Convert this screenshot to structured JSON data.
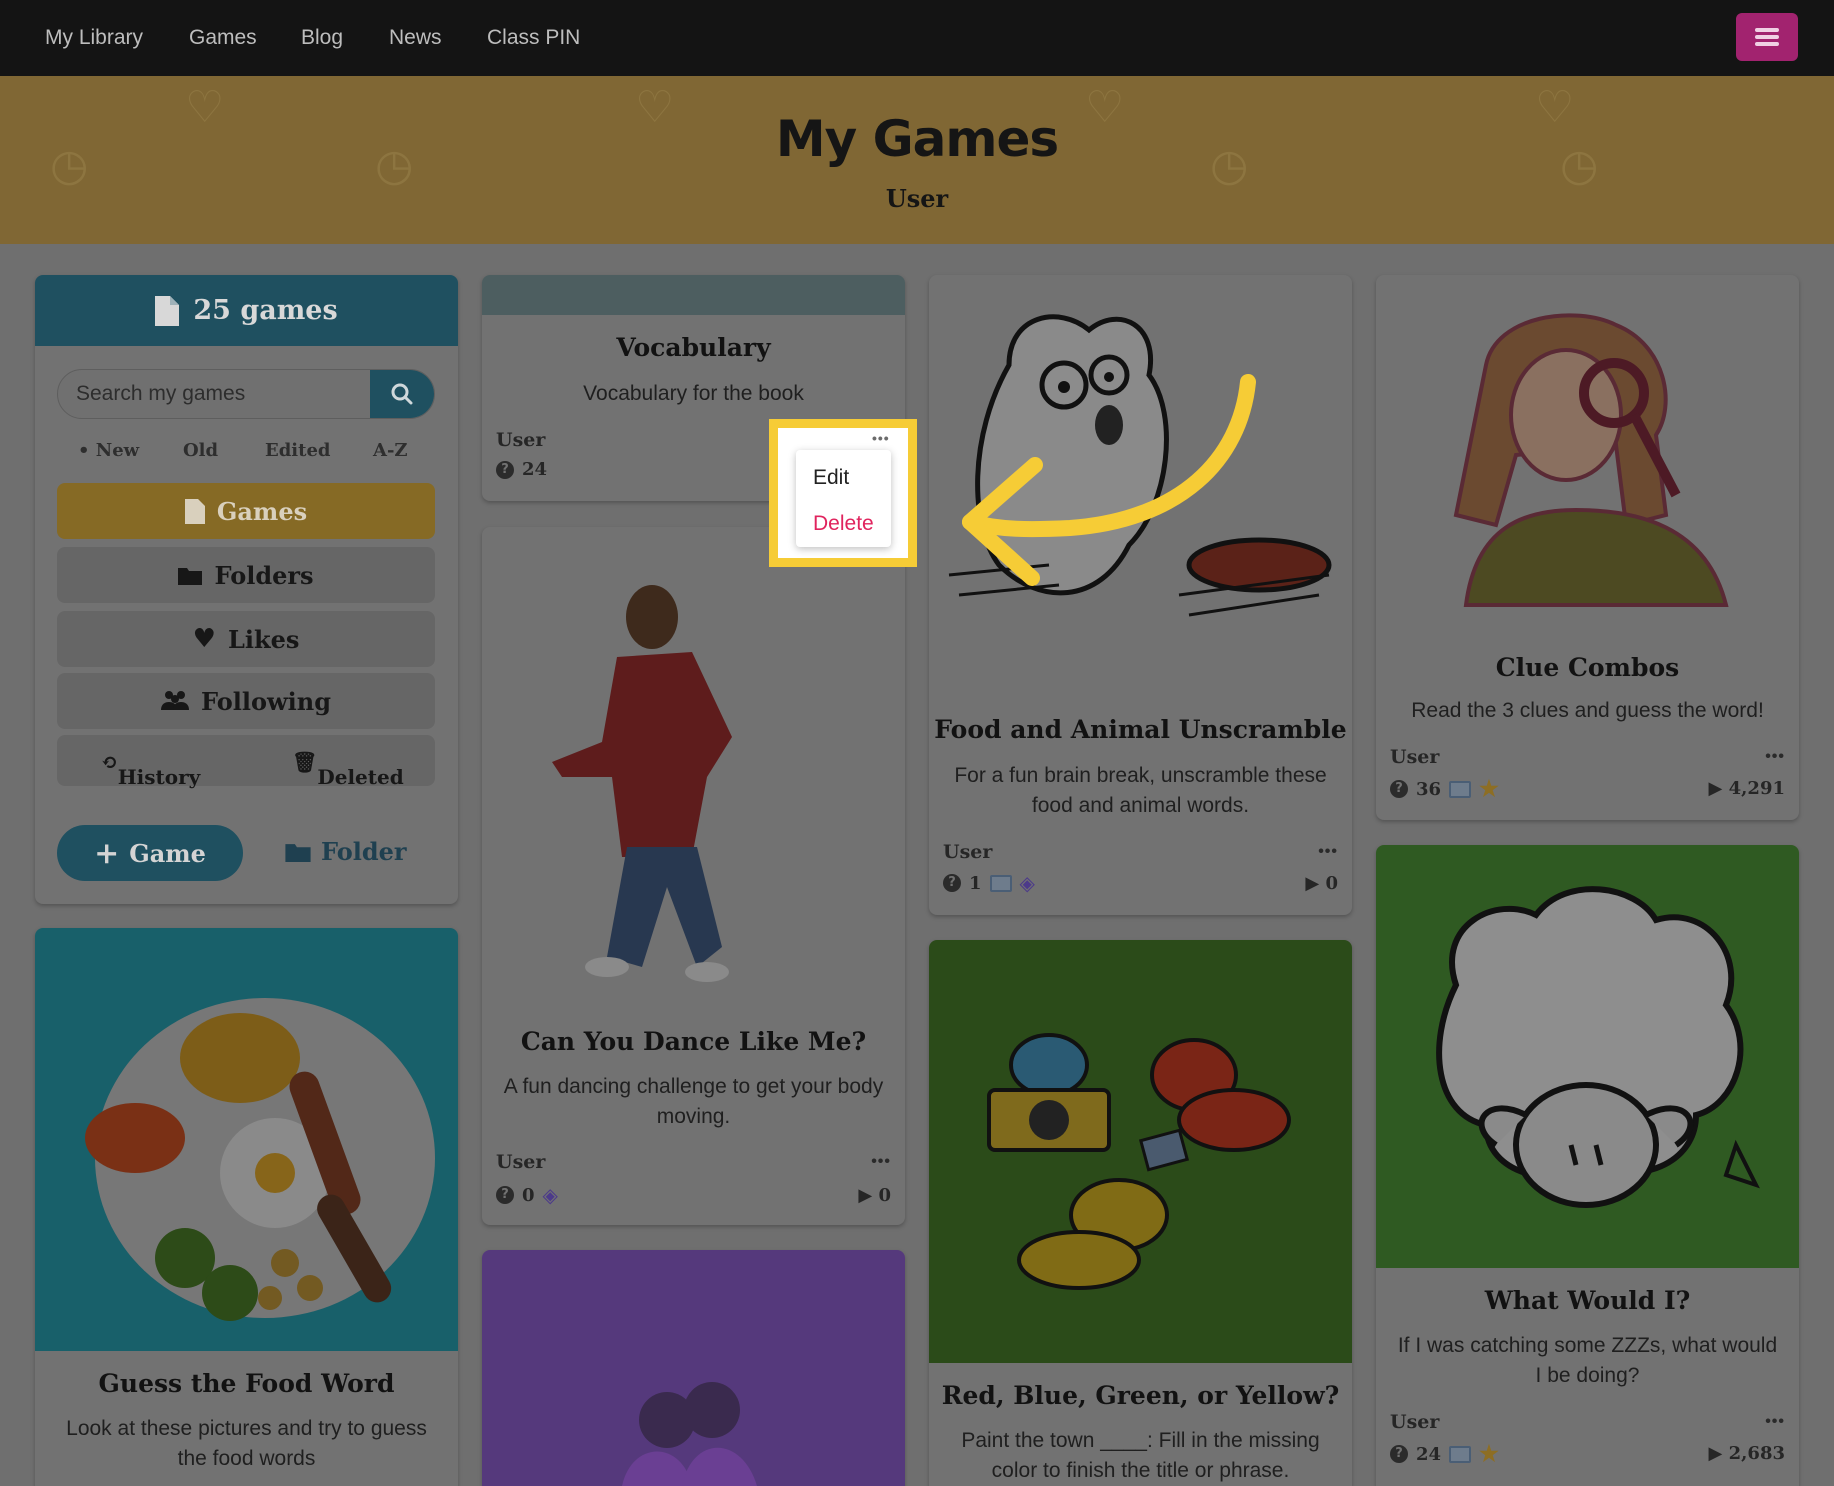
{
  "nav": {
    "items": [
      "My Library",
      "Games",
      "Blog",
      "News",
      "Class PIN"
    ]
  },
  "banner": {
    "title": "My Games",
    "subtitle": "User"
  },
  "sidebar": {
    "count_label": "25 games",
    "search_placeholder": "Search my games",
    "sort": {
      "new": "• New",
      "old": "Old",
      "edited": "Edited",
      "az": "A-Z"
    },
    "buttons": {
      "games": "Games",
      "folders": "Folders",
      "likes": "Likes",
      "following": "Following"
    },
    "history": "History",
    "deleted": "Deleted",
    "add_game": "Game",
    "add_folder": "Folder"
  },
  "menu": {
    "dots": "•••",
    "edit": "Edit",
    "delete": "Delete"
  },
  "cards": {
    "vocabulary": {
      "title": "Vocabulary",
      "desc": "Vocabulary for the book",
      "author": "User",
      "questions": "24"
    },
    "dance": {
      "title": "Can You Dance Like Me?",
      "desc": "A fun dancing challenge to get your body moving.",
      "author": "User",
      "questions": "0",
      "plays": "▶ 0",
      "dots": "•••"
    },
    "food_animal": {
      "title": "Food and Animal Unscramble",
      "desc": "For a fun brain break, unscramble these food and animal words.",
      "author": "User",
      "questions": "1",
      "plays": "▶ 0",
      "dots": "•••"
    },
    "clue_combos": {
      "title": "Clue Combos",
      "desc": "Read the 3 clues and guess the word!",
      "author": "User",
      "questions": "36",
      "plays": "▶ 4,291",
      "dots": "•••"
    },
    "guess_food": {
      "title": "Guess the Food Word",
      "desc": "Look at these pictures and try to guess the food words"
    },
    "rbgy": {
      "title": "Red, Blue, Green, or Yellow?",
      "desc": "Paint the town ____: Fill in the missing color to finish the title or phrase."
    },
    "what_would": {
      "title": "What Would I?",
      "desc": "If I was catching some ZZZs, what would I be doing?",
      "author": "User",
      "questions": "24",
      "plays": "▶ 2,683",
      "dots": "•••"
    }
  },
  "colors": {
    "nav_bg": "#141414",
    "banner_bg": "#806734",
    "accent_teal": "#1f5060",
    "accent_gold": "#866a25",
    "highlight": "#f6cc36",
    "delete_red": "#e0245e",
    "menu_button": "#a2236f"
  }
}
